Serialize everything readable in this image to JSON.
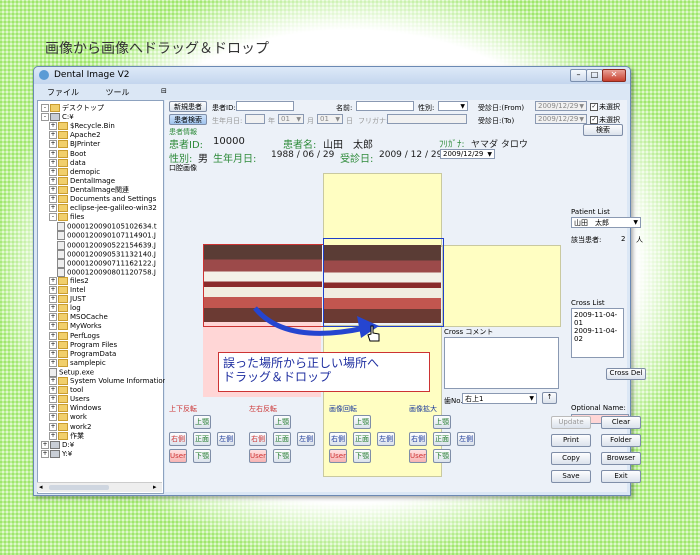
{
  "page_heading": "画像から画像へドラッグ＆ドロップ",
  "window": {
    "title": "Dental Image V2"
  },
  "menu": [
    "ファイル",
    "ツール"
  ],
  "tree": [
    {
      "label": "デスクトップ",
      "level": 0,
      "kind": "folder",
      "exp": "-"
    },
    {
      "label": "C:¥",
      "level": 0,
      "kind": "drive",
      "exp": "-"
    },
    {
      "label": "$Recycle.Bin",
      "level": 1,
      "kind": "folder",
      "exp": "+"
    },
    {
      "label": "Apache2",
      "level": 1,
      "kind": "folder",
      "exp": "+"
    },
    {
      "label": "BJPrinter",
      "level": 1,
      "kind": "folder",
      "exp": "+"
    },
    {
      "label": "Boot",
      "level": 1,
      "kind": "folder",
      "exp": "+"
    },
    {
      "label": "data",
      "level": 1,
      "kind": "folder",
      "exp": "+"
    },
    {
      "label": "demopic",
      "level": 1,
      "kind": "folder",
      "exp": "+"
    },
    {
      "label": "DentalImage",
      "level": 1,
      "kind": "folder",
      "exp": "+"
    },
    {
      "label": "DentalImage関連",
      "level": 1,
      "kind": "folder",
      "exp": "+"
    },
    {
      "label": "Documents and Settings",
      "level": 1,
      "kind": "folder",
      "exp": "+"
    },
    {
      "label": "eclipse-jee-galileo-win32",
      "level": 1,
      "kind": "folder",
      "exp": "+"
    },
    {
      "label": "files",
      "level": 1,
      "kind": "folder",
      "exp": "-"
    },
    {
      "label": "0000120090105102634.t",
      "level": 2,
      "kind": "file",
      "exp": ""
    },
    {
      "label": "0000120090107114901.J",
      "level": 2,
      "kind": "file",
      "exp": ""
    },
    {
      "label": "0000120090522154639.J",
      "level": 2,
      "kind": "file",
      "exp": ""
    },
    {
      "label": "0000120090531132140.J",
      "level": 2,
      "kind": "file",
      "exp": ""
    },
    {
      "label": "0000120090711162122.J",
      "level": 2,
      "kind": "file",
      "exp": ""
    },
    {
      "label": "0000120090801120758.J",
      "level": 2,
      "kind": "file",
      "exp": ""
    },
    {
      "label": "files2",
      "level": 1,
      "kind": "folder",
      "exp": "+"
    },
    {
      "label": "Intel",
      "level": 1,
      "kind": "folder",
      "exp": "+"
    },
    {
      "label": "JUST",
      "level": 1,
      "kind": "folder",
      "exp": "+"
    },
    {
      "label": "log",
      "level": 1,
      "kind": "folder",
      "exp": "+"
    },
    {
      "label": "MSOCache",
      "level": 1,
      "kind": "folder",
      "exp": "+"
    },
    {
      "label": "MyWorks",
      "level": 1,
      "kind": "folder",
      "exp": "+"
    },
    {
      "label": "PerfLogs",
      "level": 1,
      "kind": "folder",
      "exp": "+"
    },
    {
      "label": "Program Files",
      "level": 1,
      "kind": "folder",
      "exp": "+"
    },
    {
      "label": "ProgramData",
      "level": 1,
      "kind": "folder",
      "exp": "+"
    },
    {
      "label": "samplepic",
      "level": 1,
      "kind": "folder",
      "exp": "+"
    },
    {
      "label": "Setup.exe",
      "level": 1,
      "kind": "file",
      "exp": ""
    },
    {
      "label": "System Volume Information",
      "level": 1,
      "kind": "folder",
      "exp": "+"
    },
    {
      "label": "tool",
      "level": 1,
      "kind": "folder",
      "exp": "+"
    },
    {
      "label": "Users",
      "level": 1,
      "kind": "folder",
      "exp": "+"
    },
    {
      "label": "Windows",
      "level": 1,
      "kind": "folder",
      "exp": "+"
    },
    {
      "label": "work",
      "level": 1,
      "kind": "folder",
      "exp": "+"
    },
    {
      "label": "work2",
      "level": 1,
      "kind": "folder",
      "exp": "+"
    },
    {
      "label": "作業",
      "level": 1,
      "kind": "folder",
      "exp": "+"
    },
    {
      "label": "D:¥",
      "level": 0,
      "kind": "drive",
      "exp": "+"
    },
    {
      "label": "Y:¥",
      "level": 0,
      "kind": "drive",
      "exp": "+"
    }
  ],
  "search": {
    "new_patient_btn": "新規患者",
    "patient_id_label": "患者ID:",
    "name_label": "名前:",
    "sex_label": "性別:",
    "visit_from_label": "受診日:(From)",
    "visit_from_value": "2009/12/29",
    "unselected_label": "未選択",
    "patient_search_btn": "患者検索",
    "birth_label": "生年月日:",
    "year_label": "年",
    "month_value": "01",
    "month_label": "月",
    "day_value": "01",
    "day_label": "日",
    "furigana_label": "フリガナ:",
    "visit_to_label": "受診日:(To)",
    "visit_to_value": "2009/12/29",
    "search_btn": "検索"
  },
  "patient_info": {
    "section_label": "患者情報",
    "id_label": "患者ID:",
    "id_value": "10000",
    "name_label": "患者名:",
    "name_value": "山田　太郎",
    "furigana_label": "ﾌﾘｶﾞﾅ:",
    "furigana_value": "ヤマダ タロウ",
    "sex_label": "性別:",
    "sex_value": "男",
    "birth_label": "生年月日:",
    "birth_value": "1988 / 06 / 29",
    "visit_label": "受診日:",
    "visit_value": "2009 / 12 / 29",
    "visit_select": "2009/12/29",
    "image_section_label": "口腔画像"
  },
  "annotation": {
    "callout_line1": "誤った場所から正しい場所へ",
    "callout_line2": "ドラッグ＆ドロップ"
  },
  "right": {
    "patient_list_label": "Patient List",
    "patient_list_value": "山田　太郎",
    "count_label": "該当患者:",
    "count_value": "2",
    "count_unit": "人",
    "cross_list_label": "Cross List",
    "cross_list_items": [
      "2009-11-04-01",
      "2009-11-04-02"
    ],
    "cross_del_btn": "Cross Del",
    "optional_name_label": "Optional Name:"
  },
  "cross_comment_label": "Cross コメント",
  "tooth": {
    "label": "歯No.",
    "value": "右上1",
    "up_btn": "↑"
  },
  "groups": [
    {
      "title": "上下反転",
      "color": "red"
    },
    {
      "title": "左右反転",
      "color": "red"
    },
    {
      "title": "画像回転",
      "color": "blue"
    },
    {
      "title": "画像拡大",
      "color": "blue"
    }
  ],
  "group_buttons": {
    "upper": "上顎",
    "right": "右側",
    "front": "正面",
    "left": "左側",
    "user": "User",
    "lower": "下顎"
  },
  "actions": {
    "update": "Update",
    "clear": "Clear",
    "print": "Print",
    "folder": "Folder",
    "copy": "Copy",
    "browser": "Browser",
    "save": "Save",
    "exit": "Exit"
  }
}
